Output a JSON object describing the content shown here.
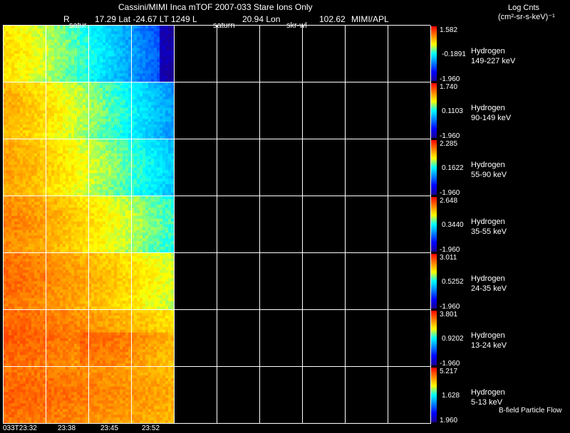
{
  "header": {
    "title": "Cassini/MIMI Inca mTOF  2007-033   Stare   Ions Only",
    "r_label": "R",
    "lat_lt_l": "17.29 Lat -24.67 LT 1249 L",
    "lon": "20.94 Lon",
    "value_right": "102.62",
    "credit": "MIMI/APL",
    "units_line1": "Log Cnts",
    "units_line2": "(cm²-sr-s-keV)⁻¹",
    "marker_satur": "satur",
    "marker_saturn": "saturn",
    "marker_skr": "skr-wl"
  },
  "footer": {
    "bfield": "B-field Particle Flow"
  },
  "colors": {
    "background": "#000000",
    "grid": "#ffffff",
    "colorbar": [
      "#1a0090",
      "#0000ff",
      "#0080ff",
      "#00ffff",
      "#ffff00",
      "#ff8000",
      "#ff0000"
    ]
  },
  "chart_data": {
    "type": "heatmap",
    "x_tick_labels": [
      "033T23:32",
      "23:38",
      "23:45",
      "23:52"
    ],
    "panels": [
      {
        "species": "Hydrogen",
        "energy": "149-227 keV",
        "cb_max": "1.582",
        "cb_mid": "-0.1891",
        "cb_min": "-1.960",
        "vmax": 1.582,
        "vmin": -1.96
      },
      {
        "species": "Hydrogen",
        "energy": "90-149 keV",
        "cb_max": "1.740",
        "cb_mid": "0.1103",
        "cb_min": "-1.960",
        "vmax": 1.74,
        "vmin": -1.96
      },
      {
        "species": "Hydrogen",
        "energy": "55-90 keV",
        "cb_max": "2.285",
        "cb_mid": "0.1622",
        "cb_min": "-1.960",
        "vmax": 2.285,
        "vmin": -1.96
      },
      {
        "species": "Hydrogen",
        "energy": "35-55 keV",
        "cb_max": "2.648",
        "cb_mid": "0.3440",
        "cb_min": "-1.960",
        "vmax": 2.648,
        "vmin": -1.96
      },
      {
        "species": "Hydrogen",
        "energy": "24-35 keV",
        "cb_max": "3.011",
        "cb_mid": "0.5252",
        "cb_min": "-1.960",
        "vmax": 3.011,
        "vmin": -1.96
      },
      {
        "species": "Hydrogen",
        "energy": "13-24 keV",
        "cb_max": "3.801",
        "cb_mid": "0.9202",
        "cb_min": "-1.960",
        "vmax": 3.801,
        "vmin": -1.96
      },
      {
        "species": "Hydrogen",
        "energy": "5-13 keV",
        "cb_max": "5.217",
        "cb_mid": "1.628",
        "cb_min": "1.960",
        "vmax": 5.217,
        "vmin": 1.96
      }
    ]
  }
}
